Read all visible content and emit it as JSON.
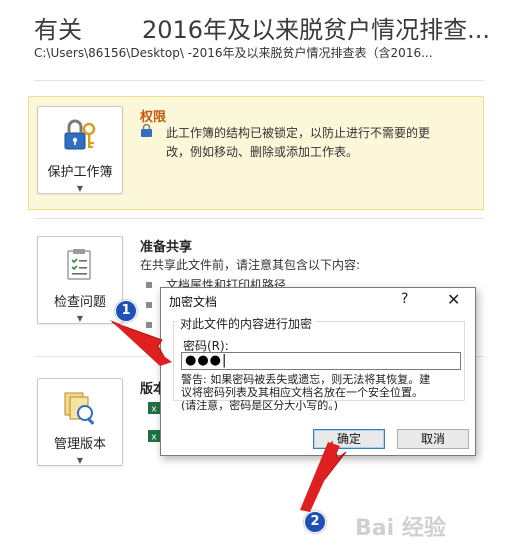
{
  "header": {
    "title": "有关",
    "doc_title": "2016年及以来脱贫户情况排查...",
    "path": "C:\\Users\\86156\\Desktop\\        -2016年及以来脱贫户情况排查表（含2016..."
  },
  "permissions": {
    "button_label": "保护工作簿",
    "title": "权限",
    "text_line1": "此工作簿的结构已被锁定，以防止进行不需要的更",
    "text_line2": "改，例如移动、删除或添加工作表。",
    "title_color": "#c55a11"
  },
  "prepare_share": {
    "button_label": "检查问题",
    "title": "准备共享",
    "text": "在共享此文件前，请注意其包含以下内容:",
    "item1": "文档属性和打印机路径"
  },
  "versions": {
    "button_label": "管理版本",
    "title": "版本"
  },
  "dialog": {
    "title": "加密文档",
    "help": "?",
    "close": "✕",
    "group_label": "对此文件的内容进行加密",
    "password_label": "密码(R):",
    "password_value": "●●●|",
    "warning_line1": "警告: 如果密码被丢失或遗忘，则无法将其恢复。建",
    "warning_line2": "议将密码列表及其相应文档名放在一个安全位置。",
    "warning_line3": "(请注意，密码是区分大小写的。)",
    "ok_label": "确定",
    "cancel_label": "取消"
  },
  "annotations": {
    "badge1": "1",
    "badge2": "2",
    "arrow_color": "#e02020",
    "badge_color": "#1e50b8"
  },
  "watermark": "Bai 经验"
}
